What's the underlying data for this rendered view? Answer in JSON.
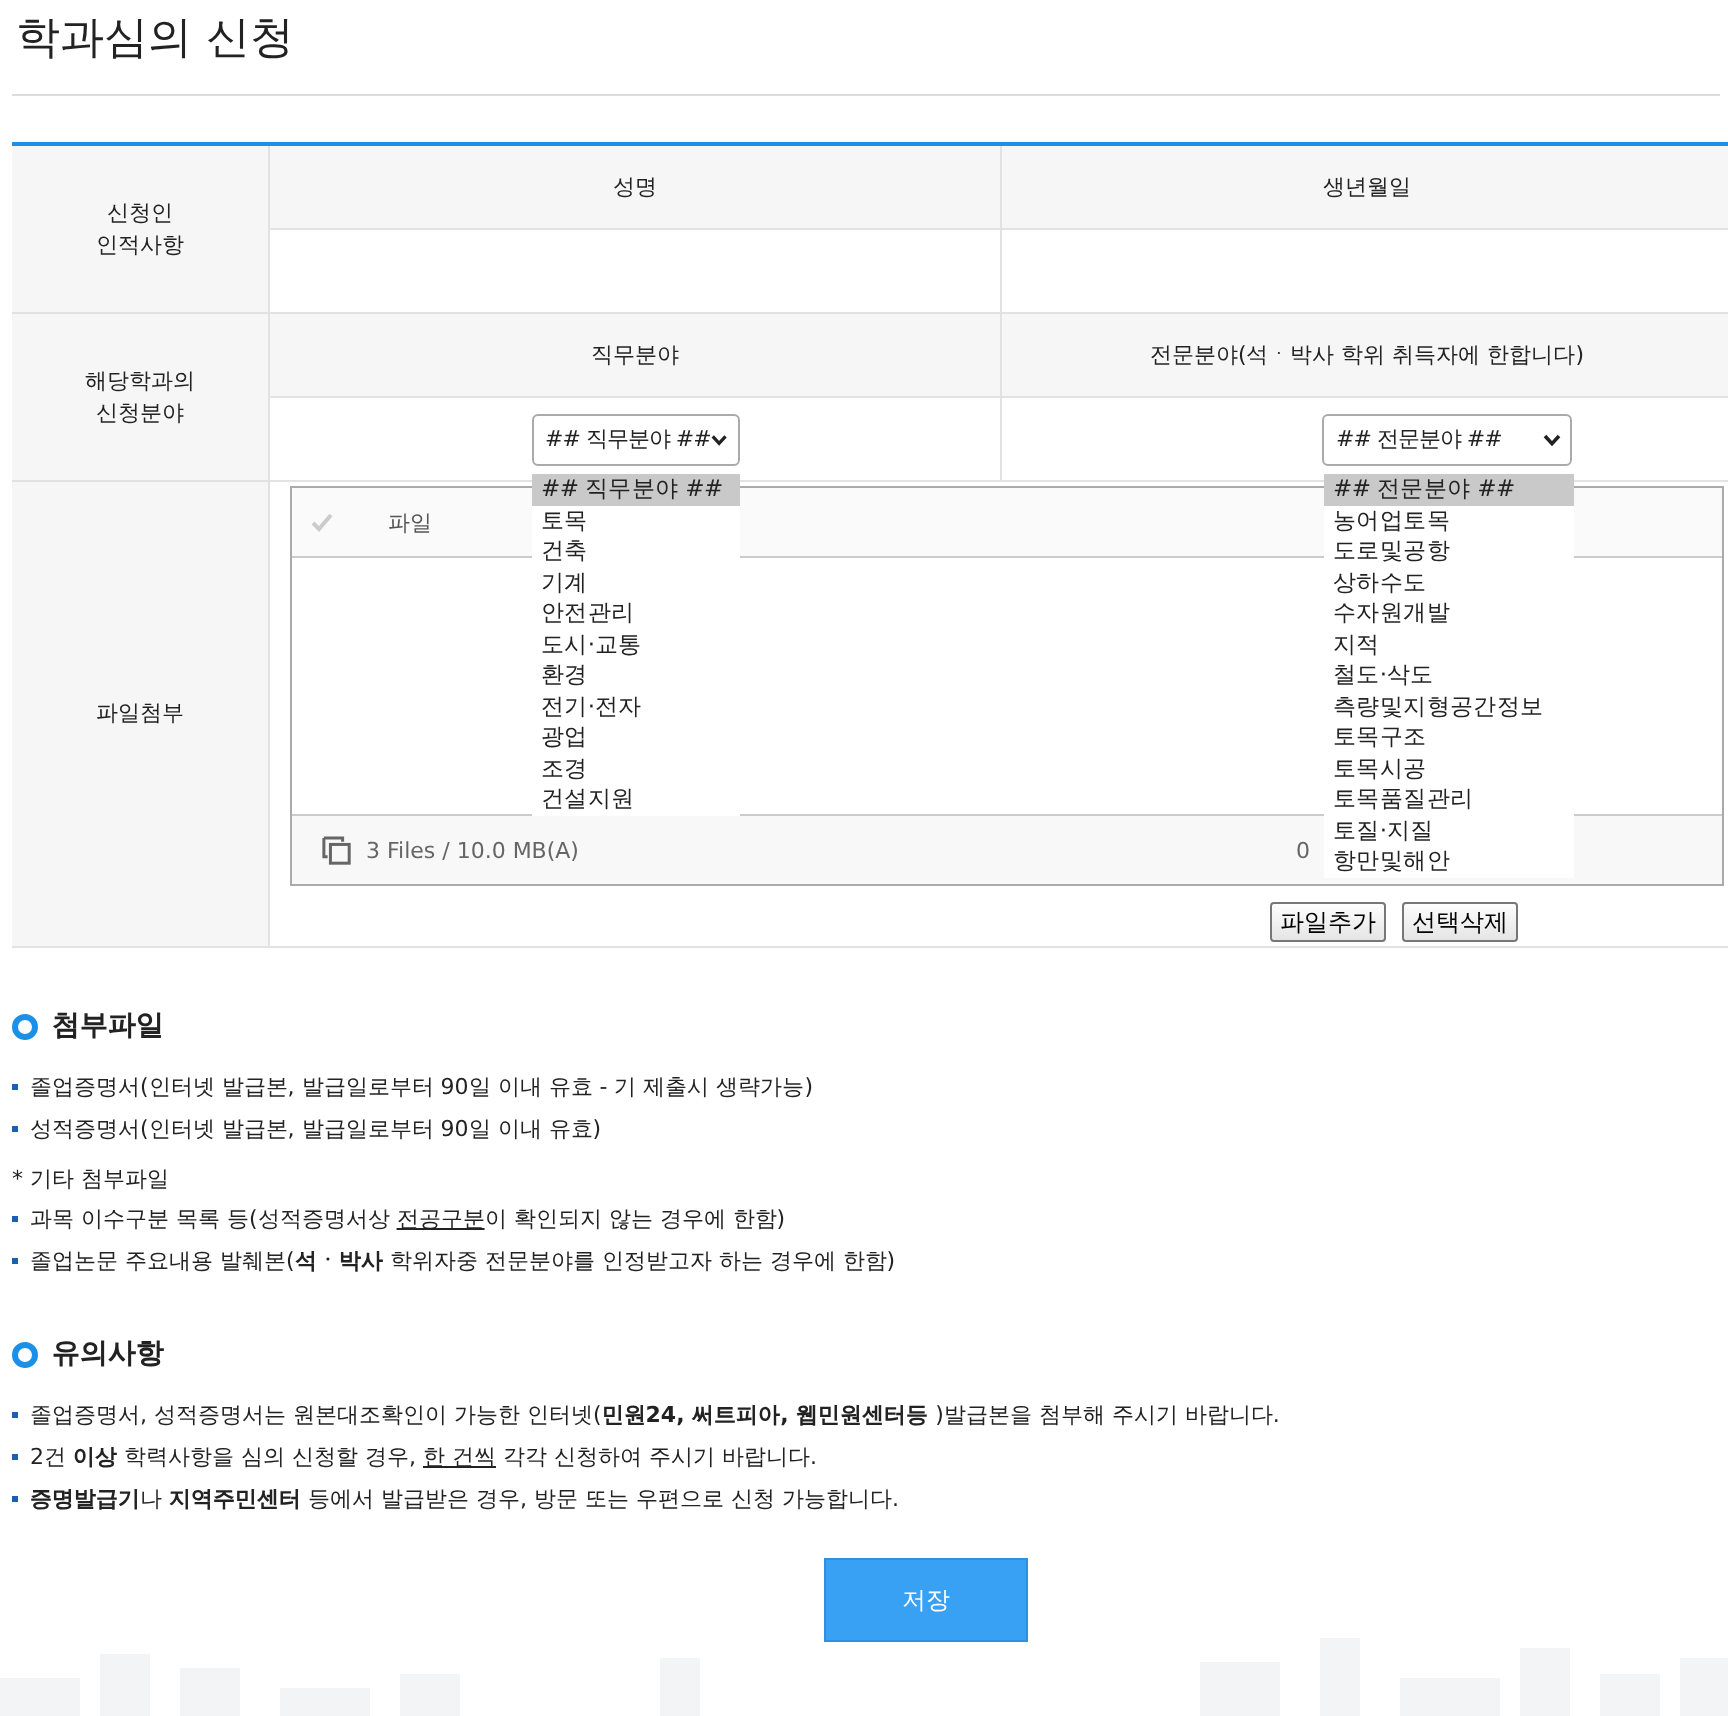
{
  "page_title": "학과심의 신청",
  "form": {
    "applicant": {
      "label": "신청인\n인적사항",
      "columns": [
        {
          "heading": "성명"
        },
        {
          "heading": "생년월일"
        }
      ]
    },
    "field": {
      "label": "해당학과의\n신청분야",
      "columns": [
        {
          "heading": "직무분야",
          "select": {
            "value": "## 직무분야 ##",
            "expanded": true,
            "options": [
              {
                "label": "## 직무분야 ##",
                "selected": true
              },
              {
                "label": "토목",
                "selected": false
              },
              {
                "label": "건축",
                "selected": false
              },
              {
                "label": "기계",
                "selected": false
              },
              {
                "label": "안전관리",
                "selected": false
              },
              {
                "label": "도시·교통",
                "selected": false
              },
              {
                "label": "환경",
                "selected": false
              },
              {
                "label": "전기·전자",
                "selected": false
              },
              {
                "label": "광업",
                "selected": false
              },
              {
                "label": "조경",
                "selected": false
              },
              {
                "label": "건설지원",
                "selected": false
              }
            ]
          }
        },
        {
          "heading": "전문분야(석ㆍ박사 학위 취득자에 한합니다)",
          "select": {
            "value": "## 전문분야 ##",
            "expanded": true,
            "options": [
              {
                "label": "## 전문분야 ##",
                "selected": true
              },
              {
                "label": "농어업토목",
                "selected": false
              },
              {
                "label": "도로및공항",
                "selected": false
              },
              {
                "label": "상하수도",
                "selected": false
              },
              {
                "label": "수자원개발",
                "selected": false
              },
              {
                "label": "지적",
                "selected": false
              },
              {
                "label": "철도·삭도",
                "selected": false
              },
              {
                "label": "측량및지형공간정보",
                "selected": false
              },
              {
                "label": "토목구조",
                "selected": false
              },
              {
                "label": "토목시공",
                "selected": false
              },
              {
                "label": "토목품질관리",
                "selected": false
              },
              {
                "label": "토질·지질",
                "selected": false
              },
              {
                "label": "항만및해안",
                "selected": false
              }
            ]
          }
        }
      ]
    },
    "attachment": {
      "label": "파일첨부",
      "file_column": "파일",
      "summary": "3 Files / 10.0 MB(A)",
      "column_2_footer": "0",
      "buttons": [
        "파일추가",
        "선택삭제"
      ]
    }
  },
  "sections": [
    {
      "title": "첨부파일",
      "groups": [
        {
          "items": [
            [
              {
                "text": "졸업증명서(인터넷 발급본, 발급일로부터 90일 이내 유효 - 기 제출시 생략가능)"
              }
            ],
            [
              {
                "text": "성적증명서(인터넷 발급본, 발급일로부터 90일 이내 유효)"
              }
            ]
          ]
        },
        {
          "heading": "* 기타 첨부파일",
          "items": [
            [
              {
                "text": "과목 이수구분 목록 등(성적증명서상 "
              },
              {
                "text": "전공구분",
                "underline": true
              },
              {
                "text": "이 확인되지 않는 경우에 한함)"
              }
            ],
            [
              {
                "text": "졸업논문 주요내용 발췌본(**석ㆍ박사** 학위자중 전문분야를 인정받고자 하는 경우에 한함)"
              }
            ]
          ]
        }
      ]
    },
    {
      "title": "유의사항",
      "groups": [
        {
          "items": [
            [
              {
                "text": "졸업증명서, 성적증명서는 원본대조확인이 가능한 인터넷(**민원24, 써트피아, 웹민원센터등** )발급본을 첨부해 주시기 바랍니다."
              }
            ],
            [
              {
                "text": "2건 **이상** 학력사항을 심의 신청할 경우, "
              },
              {
                "text": "한 건씩",
                "underline": true
              },
              {
                "text": " 각각 신청하여 주시기 바랍니다."
              }
            ],
            [
              {
                "text": "**증명발급기**나 **지역주민센터** 등에서 발급받은 경우, 방문 또는 우편으로 신청 가능합니다."
              }
            ]
          ]
        }
      ]
    }
  ],
  "save_button": "저장"
}
